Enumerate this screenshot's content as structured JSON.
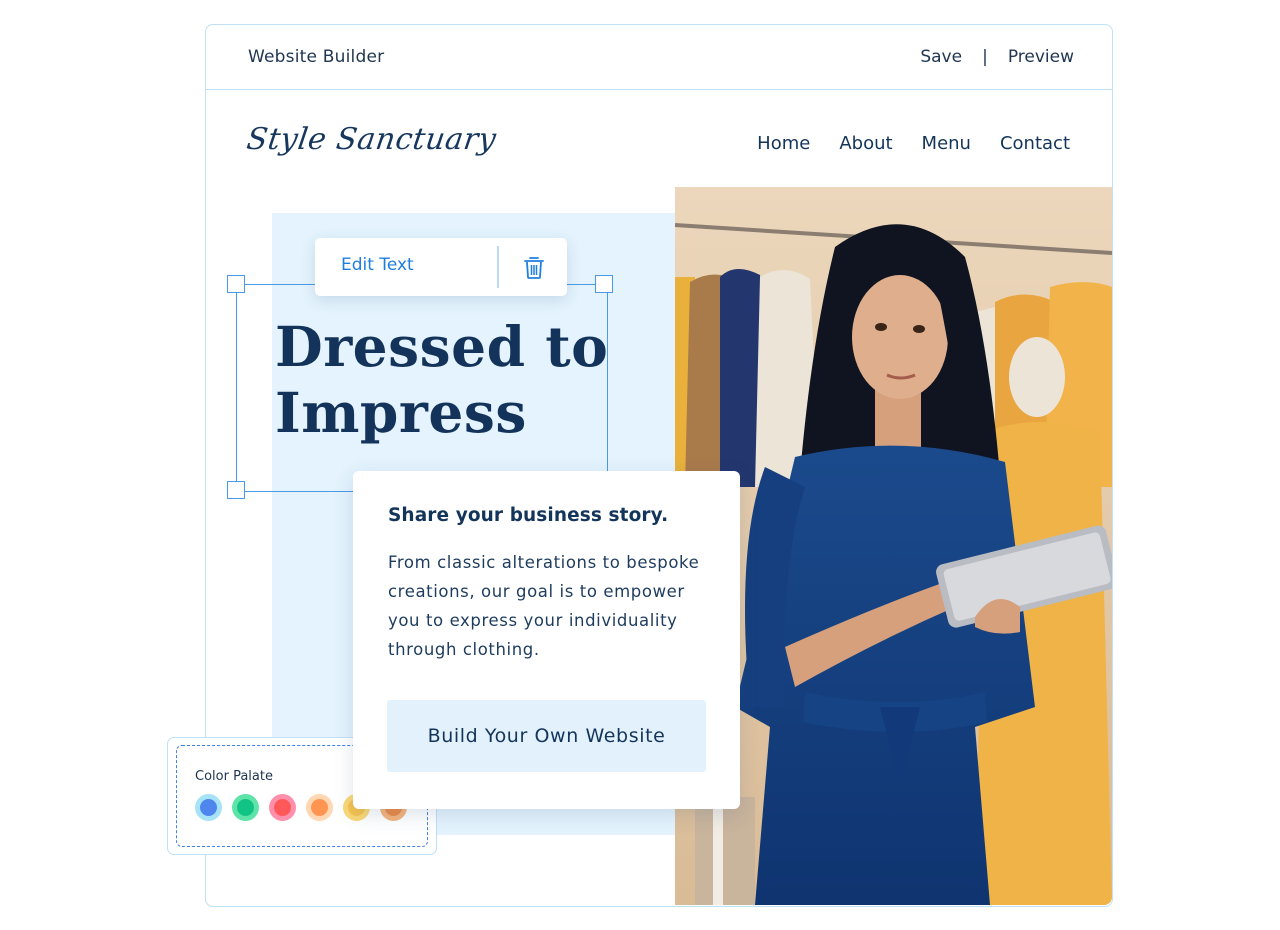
{
  "app": {
    "title": "Website Builder",
    "actions": {
      "save": "Save",
      "separator": "|",
      "preview": "Preview"
    }
  },
  "site": {
    "logo": "Style Sanctuary",
    "nav": [
      "Home",
      "About",
      "Menu",
      "Contact"
    ],
    "headline_line1": "Dressed to",
    "headline_line2": "Impress",
    "card": {
      "title": "Share your business story.",
      "body": "From classic alterations to bespoke creations, our goal is to empower you to express your individuality through clothing.",
      "cta": "Build Your Own Website"
    },
    "hero_image": {
      "icon": "photo-woman-with-tablet",
      "alt": "Woman in navy dress holding a tablet in a clothing boutique"
    }
  },
  "editor": {
    "toolbar": {
      "edit_label": "Edit Text",
      "delete_icon": "trash-icon"
    },
    "accent_color": "#4a9be6"
  },
  "palette": {
    "label": "Color Palate",
    "swatches": [
      {
        "name": "blue",
        "outer": "#a6e3f7",
        "inner": "#4f86ee"
      },
      {
        "name": "green",
        "outer": "#5ee3a9",
        "inner": "#12c386"
      },
      {
        "name": "red",
        "outer": "#ff8fab",
        "inner": "#ff5859"
      },
      {
        "name": "orange",
        "outer": "#ffd7b2",
        "inner": "#ff9550"
      },
      {
        "name": "yellow",
        "outer": "#fbd877",
        "inner": "#f5c34f"
      },
      {
        "name": "amber",
        "outer": "#f6b47d",
        "inner": "#ea8a47"
      }
    ]
  }
}
